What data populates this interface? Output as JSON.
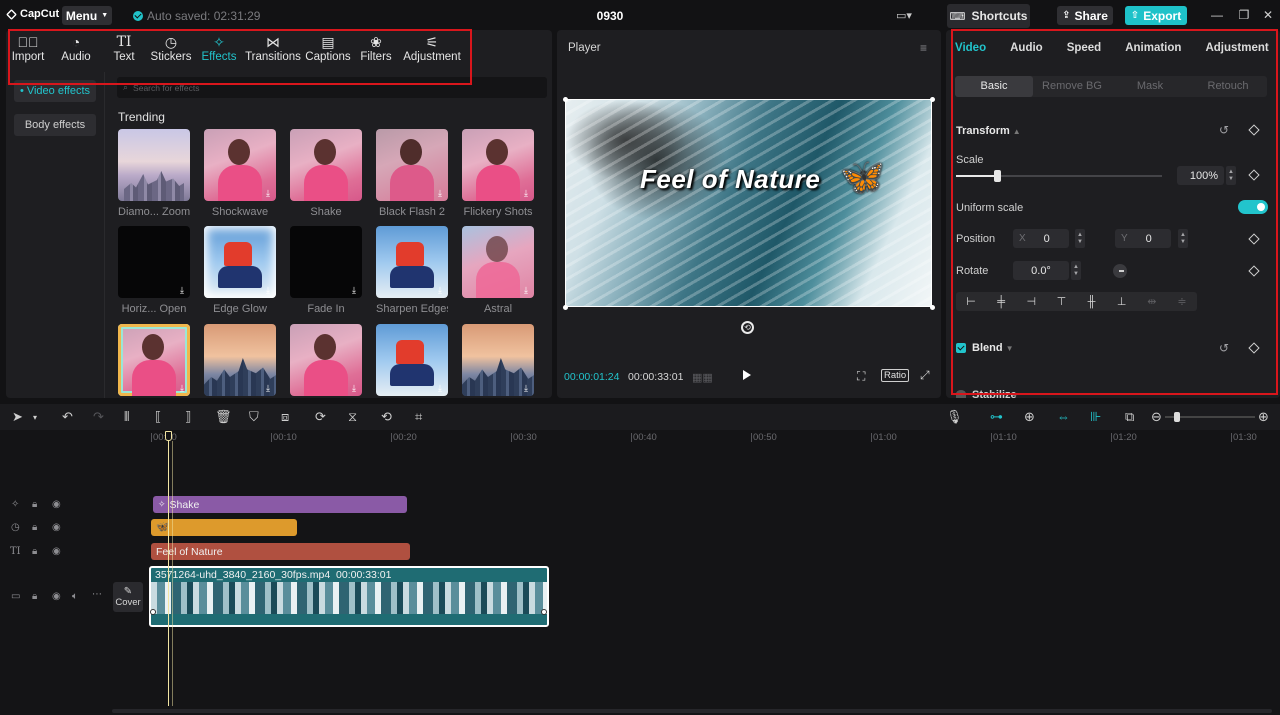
{
  "app": {
    "logo_text": "CapCut",
    "menu_label": "Menu",
    "autosave_text": "Auto saved: 02:31:29",
    "project_name": "0930",
    "shortcuts_label": "Shortcuts",
    "share_label": "Share",
    "export_label": "Export"
  },
  "toolbar": {
    "items": [
      {
        "label": "Import",
        "icon": "import-icon"
      },
      {
        "label": "Audio",
        "icon": "audio-icon"
      },
      {
        "label": "Text",
        "icon": "text-icon"
      },
      {
        "label": "Stickers",
        "icon": "stickers-icon"
      },
      {
        "label": "Effects",
        "icon": "effects-icon",
        "active": true
      },
      {
        "label": "Transitions",
        "icon": "transitions-icon"
      },
      {
        "label": "Captions",
        "icon": "captions-icon"
      },
      {
        "label": "Filters",
        "icon": "filters-icon"
      },
      {
        "label": "Adjustment",
        "icon": "adjustment-icon"
      }
    ]
  },
  "effects": {
    "nav": [
      {
        "label": "• Video effects",
        "active": true
      },
      {
        "label": "Body effects",
        "active": false
      }
    ],
    "search_placeholder": "Search for effects",
    "section_title": "Trending",
    "cards": [
      {
        "label": "Diamo... Zoom"
      },
      {
        "label": "Shockwave"
      },
      {
        "label": "Shake"
      },
      {
        "label": "Black Flash 2"
      },
      {
        "label": "Flickery Shots"
      },
      {
        "label": "Horiz... Open"
      },
      {
        "label": "Edge Glow"
      },
      {
        "label": "Fade In"
      },
      {
        "label": "Sharpen Edges"
      },
      {
        "label": "Astral"
      },
      {
        "label": ""
      },
      {
        "label": ""
      },
      {
        "label": ""
      },
      {
        "label": ""
      },
      {
        "label": ""
      }
    ]
  },
  "player": {
    "title": "Player",
    "overlay_text": "Feel of Nature",
    "current_time": "00:00:01:24",
    "duration": "00:00:33:01",
    "ratio_label": "Ratio"
  },
  "inspector": {
    "tabs": [
      "Video",
      "Audio",
      "Speed",
      "Animation",
      "Adjustment"
    ],
    "subtabs": [
      "Basic",
      "Remove BG",
      "Mask",
      "Retouch"
    ],
    "transform_title": "Transform",
    "scale_label": "Scale",
    "scale_value": "100%",
    "uniform_scale_label": "Uniform scale",
    "uniform_scale_on": true,
    "position_label": "Position",
    "position_x_prefix": "X",
    "position_x": "0",
    "position_y_prefix": "Y",
    "position_y": "0",
    "rotate_label": "Rotate",
    "rotate_value": "0.0°",
    "blend_title": "Blend",
    "stabilize_title": "Stabilize"
  },
  "timeline": {
    "ruler_ticks": [
      "00:00",
      "00:10",
      "00:20",
      "00:30",
      "00:40",
      "00:50",
      "01:00",
      "01:10",
      "01:20",
      "01:30"
    ],
    "effect_clip_label": "Shake",
    "text_clip_label": "Feel of Nature",
    "main_clip_label": "3571264-uhd_3840_2160_30fps.mp4",
    "main_clip_duration": "00:00:33:01",
    "cover_label": "Cover"
  },
  "colors": {
    "accent": "#22c4cc",
    "effect_clip": "#8a5aa6",
    "sticker_clip": "#dd9a2c",
    "text_clip": "#b05040",
    "video_clip": "#1f6c73",
    "highlight_box": "#d9161c"
  }
}
